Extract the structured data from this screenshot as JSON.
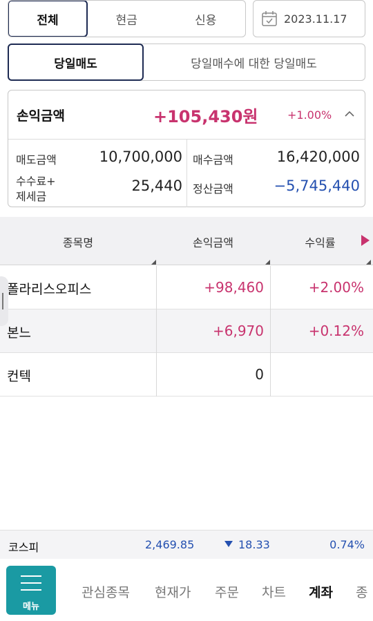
{
  "filters": {
    "account_tabs": [
      "전체",
      "현금",
      "신용"
    ],
    "active_account_tab": "전체",
    "date": "2023.11.17",
    "sale_tabs": [
      "당일매도",
      "당일매수에 대한 당일매도"
    ]
  },
  "summary": {
    "title": "손익금액",
    "amount": "+105,430원",
    "rate": "+1.00%",
    "sell_label": "매도금액",
    "sell_value": "10,700,000",
    "buy_label": "매수금액",
    "buy_value": "16,420,000",
    "fee_label_1": "수수료+",
    "fee_label_2": "제세금",
    "fee_value": "25,440",
    "settle_label": "정산금액",
    "settle_value": "−5,745,440",
    "colors": {
      "positive": "#c8336e",
      "negative": "#2450b0"
    }
  },
  "table": {
    "headers": [
      "종목명",
      "손익금액",
      "수익률"
    ],
    "rows": [
      {
        "name": "폴라리스오피스",
        "pl": "+98,460",
        "rate": "+2.00%"
      },
      {
        "name": "본느",
        "pl": "+6,970",
        "rate": "+0.12%"
      },
      {
        "name": "컨텍",
        "pl": "0",
        "rate": ""
      }
    ]
  },
  "index": {
    "name": "코스피",
    "value": "2,469.85",
    "change": "18.33",
    "rate": "0.74%"
  },
  "nav": {
    "menu_label": "메뉴",
    "items": [
      "관심종목",
      "현재가",
      "주문",
      "차트",
      "계좌",
      "종"
    ],
    "active": "계좌"
  }
}
